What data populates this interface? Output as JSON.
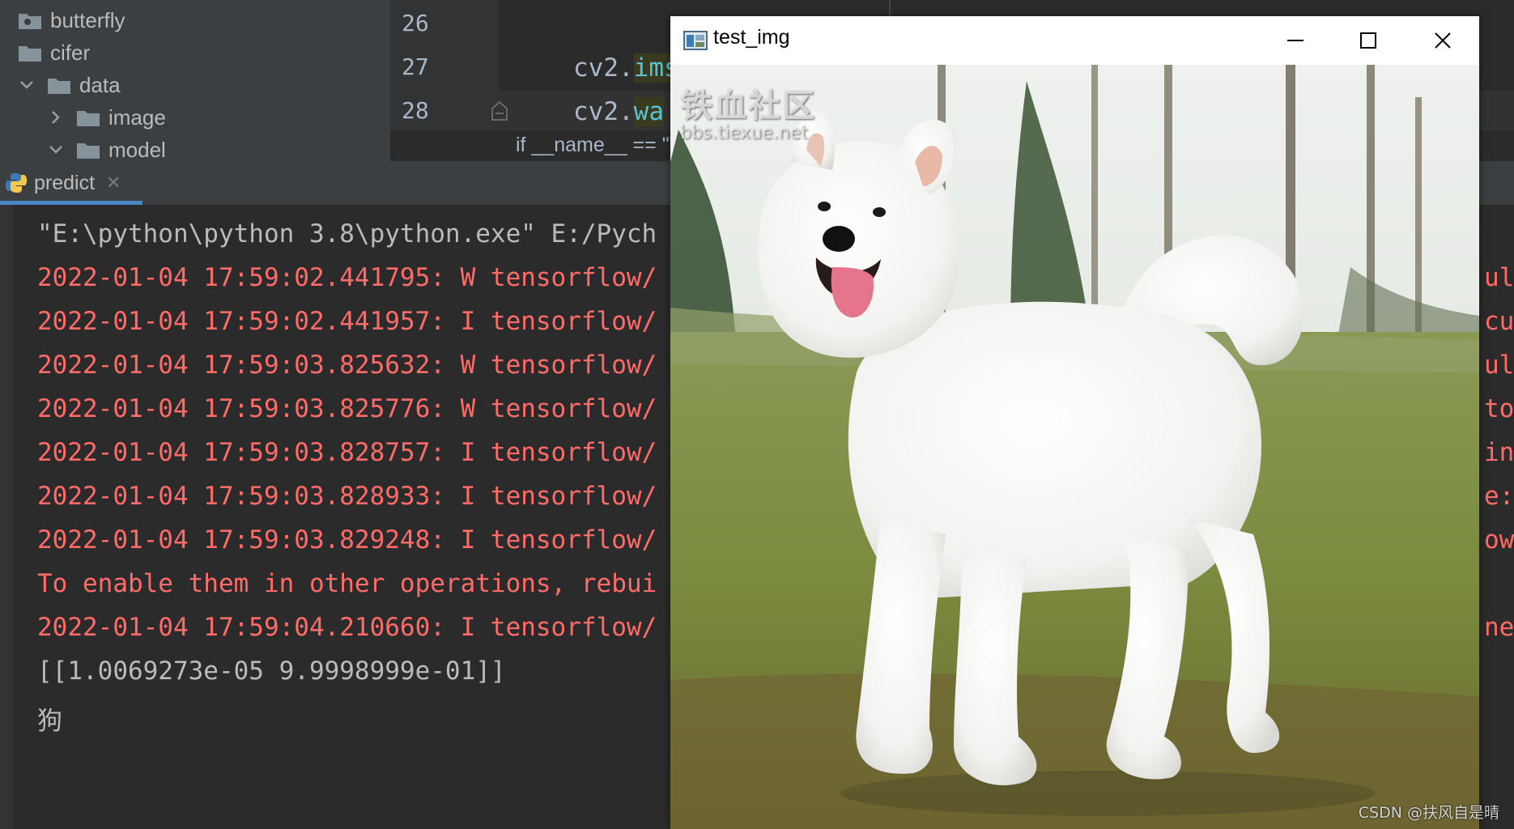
{
  "project_tree": {
    "items": [
      {
        "label": "butterfly"
      },
      {
        "label": "cifer"
      },
      {
        "label": "data"
      },
      {
        "label": "image"
      },
      {
        "label": "model"
      }
    ]
  },
  "editor": {
    "line_numbers": [
      "26",
      "27",
      "28"
    ],
    "lines": [
      {
        "prefix": "cv2.",
        "method": "ims"
      },
      {
        "prefix": "cv2.",
        "method": "wa"
      }
    ],
    "breadcrumb": "if __name__ == \""
  },
  "run_panel": {
    "tab_label": "predict",
    "console_lines": [
      {
        "text": "\"E:\\python\\python 3.8\\python.exe\" E:/Pych",
        "kind": "out"
      },
      {
        "text": "2022-01-04 17:59:02.441795: W tensorflow/",
        "kind": "err"
      },
      {
        "text": "2022-01-04 17:59:02.441957: I tensorflow/",
        "kind": "err"
      },
      {
        "text": "2022-01-04 17:59:03.825632: W tensorflow/",
        "kind": "err"
      },
      {
        "text": "2022-01-04 17:59:03.825776: W tensorflow/",
        "kind": "err"
      },
      {
        "text": "2022-01-04 17:59:03.828757: I tensorflow/",
        "kind": "err"
      },
      {
        "text": "2022-01-04 17:59:03.828933: I tensorflow/",
        "kind": "err"
      },
      {
        "text": "2022-01-04 17:59:03.829248: I tensorflow/",
        "kind": "err"
      },
      {
        "text": "To enable them in other operations, rebui",
        "kind": "err"
      },
      {
        "text": "2022-01-04 17:59:04.210660: I tensorflow/",
        "kind": "err"
      },
      {
        "text": "[[1.0069273e-05 9.9998999e-01]]",
        "kind": "out"
      },
      {
        "text": "狗",
        "kind": "out"
      }
    ],
    "right_clipped": [
      "ul",
      "cu",
      "ul",
      "to",
      "in",
      "e:",
      "ow",
      "",
      "ne"
    ]
  },
  "image_window": {
    "title": "test_img",
    "watermark_line1": "铁血社区",
    "watermark_line2": "bbs.tiexue.net"
  },
  "credit": "CSDN @扶风自是晴",
  "colors": {
    "error": "#ff6b68",
    "output": "#bbbbbb",
    "accent": "#4a88c7"
  }
}
